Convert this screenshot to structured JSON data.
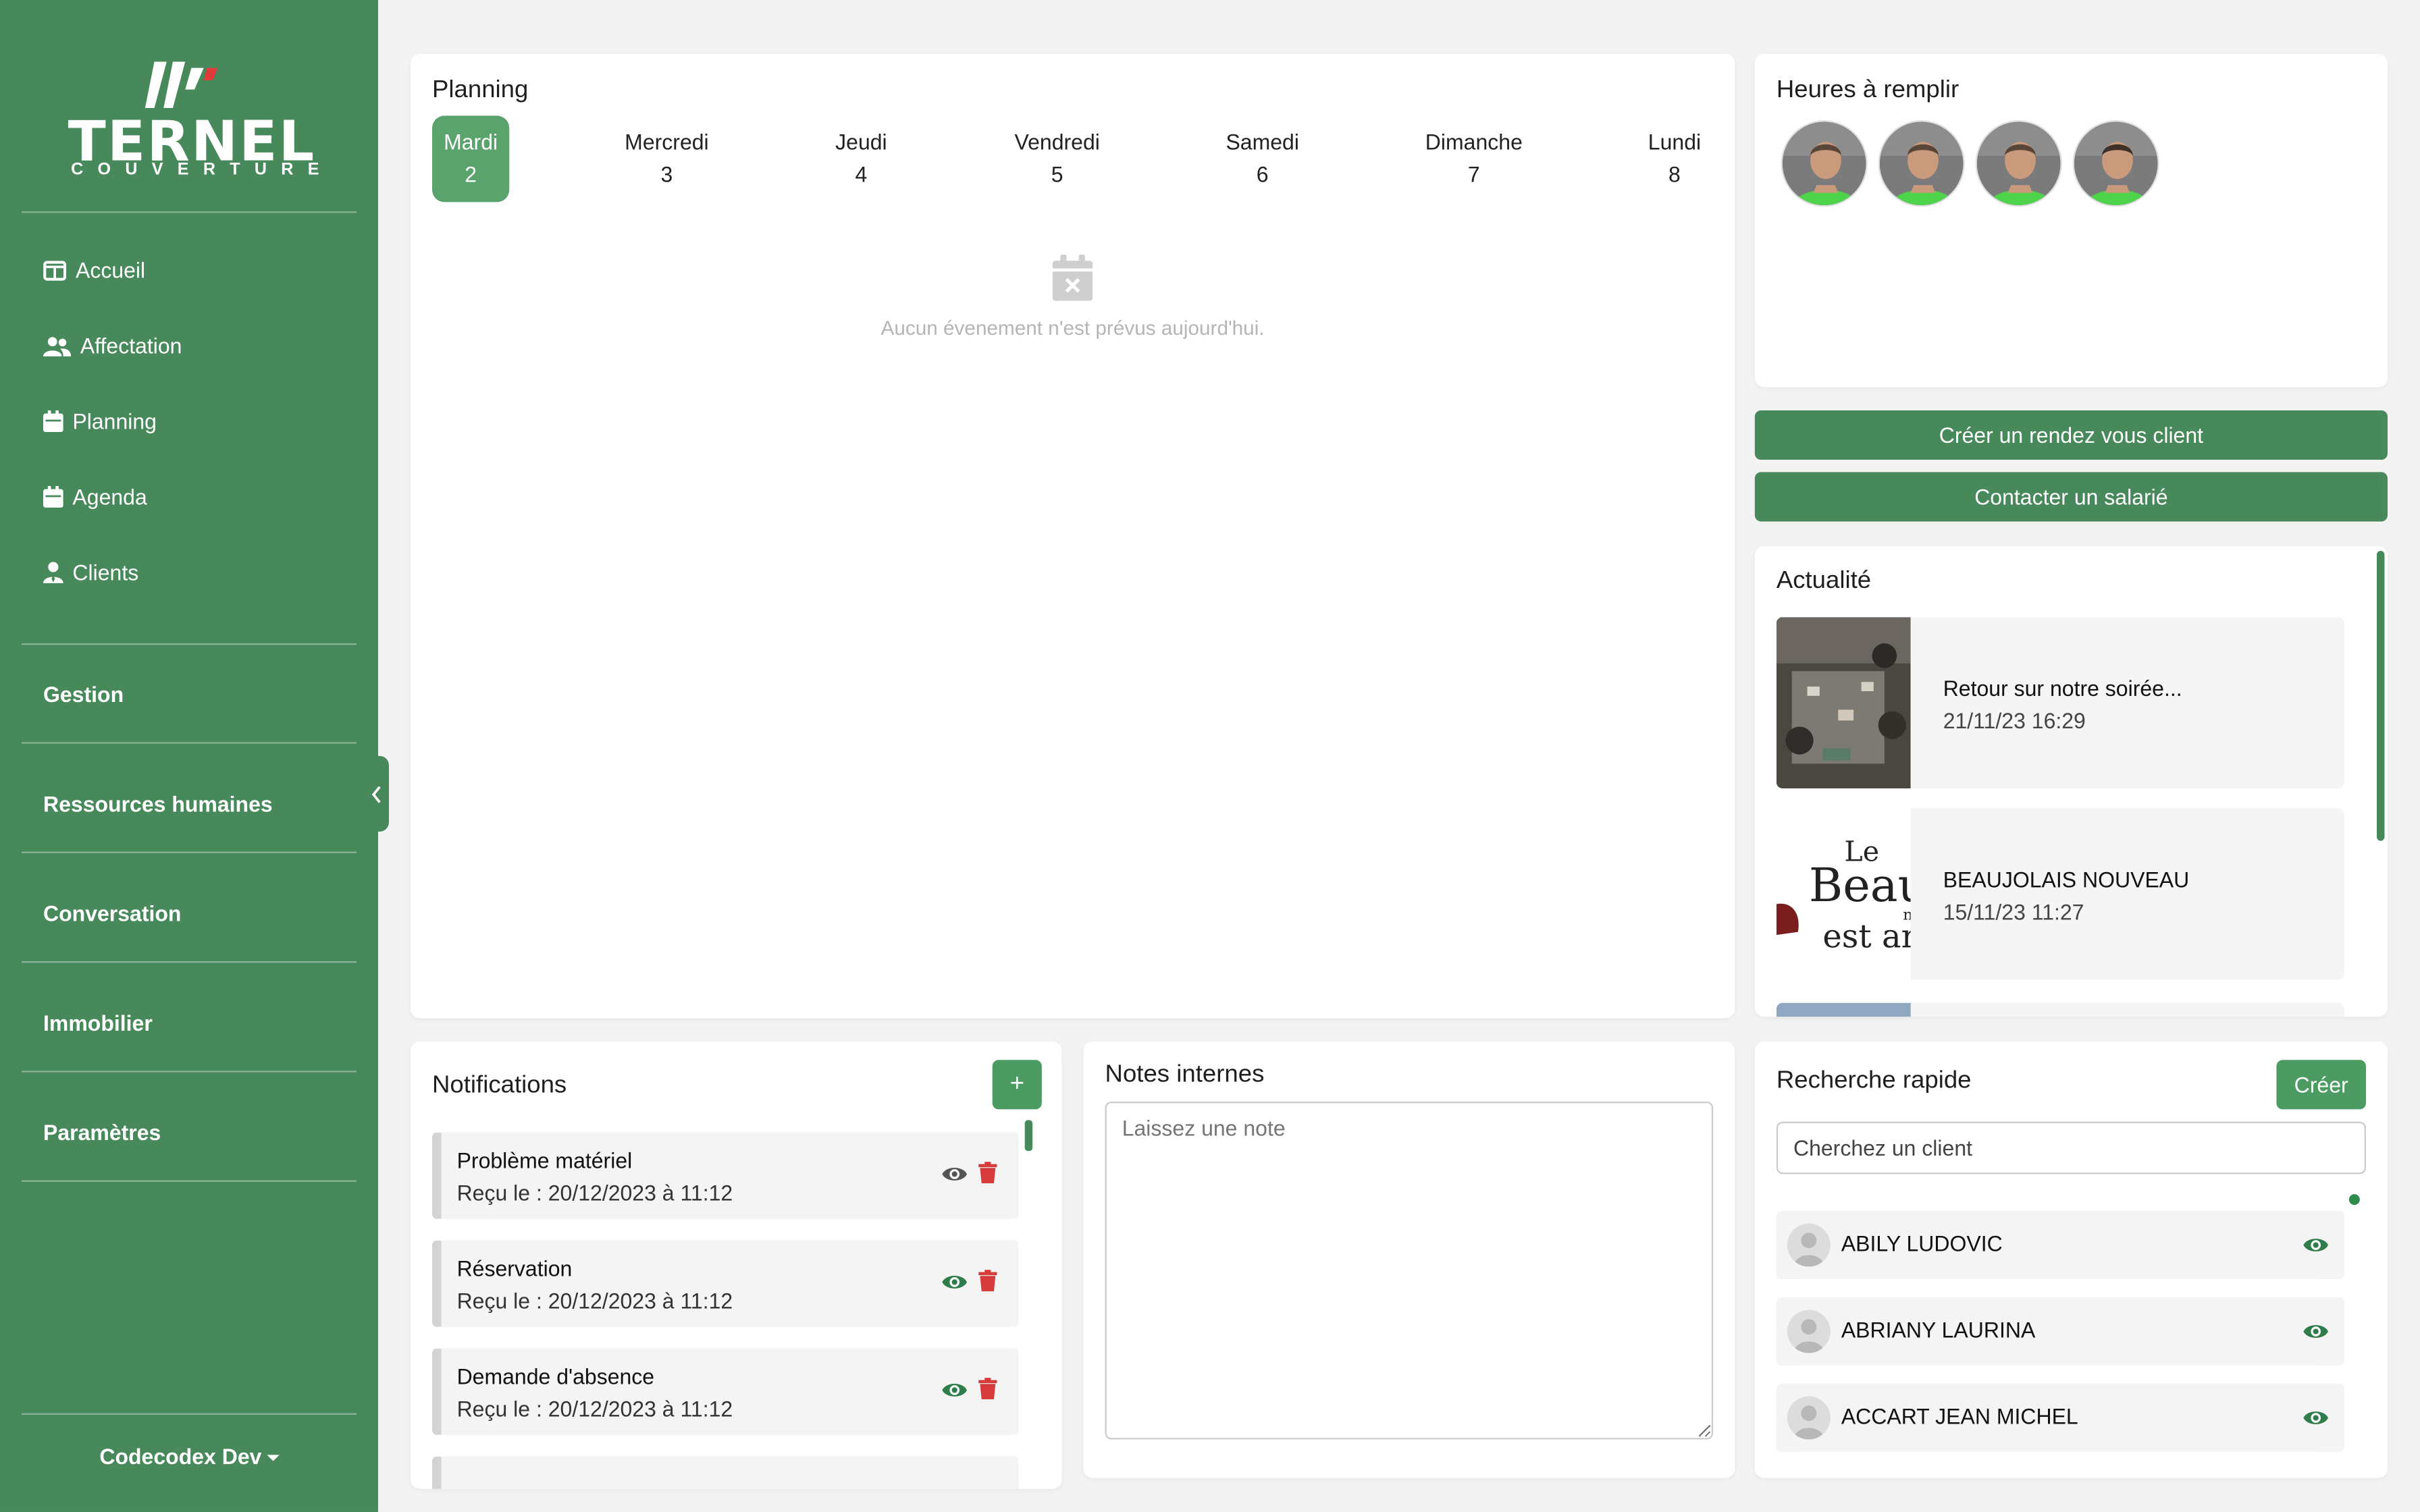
{
  "sidebar": {
    "logo_word": "TERNEL",
    "logo_sub": "COUVERTURE",
    "nav": [
      {
        "label": "Accueil",
        "icon": "table-columns-icon"
      },
      {
        "label": "Affectation",
        "icon": "users-icon"
      },
      {
        "label": "Planning",
        "icon": "calendar-icon"
      },
      {
        "label": "Agenda",
        "icon": "calendar-icon"
      },
      {
        "label": "Clients",
        "icon": "user-tie-icon"
      }
    ],
    "sections": [
      "Gestion",
      "Ressources humaines",
      "Conversation",
      "Immobilier",
      "Paramètres"
    ],
    "user": "Codecodex Dev"
  },
  "planning": {
    "title": "Planning",
    "days": [
      {
        "name": "Mardi",
        "date": "2",
        "active": true
      },
      {
        "name": "Mercredi",
        "date": "3"
      },
      {
        "name": "Jeudi",
        "date": "4"
      },
      {
        "name": "Vendredi",
        "date": "5"
      },
      {
        "name": "Samedi",
        "date": "6"
      },
      {
        "name": "Dimanche",
        "date": "7"
      },
      {
        "name": "Lundi",
        "date": "8"
      }
    ],
    "empty_text": "Aucun évenement n'est prévus aujourd'hui."
  },
  "heures": {
    "title": "Heures à remplir",
    "avatar_count": 4
  },
  "actions": {
    "create_rdv": "Créer un rendez vous client",
    "contact": "Contacter un salarié"
  },
  "actualite": {
    "title": "Actualité",
    "items": [
      {
        "title": "Retour sur notre soirée...",
        "date": "21/11/23 16:29"
      },
      {
        "title": "BEAUJOLAIS NOUVEAU",
        "date": "15/11/23 11:27"
      }
    ],
    "beaujolais_image_text": [
      "Le",
      "Beaujo",
      "n",
      "est arr"
    ]
  },
  "notifications": {
    "title": "Notifications",
    "add_label": "+",
    "items": [
      {
        "title": "Problème matériel",
        "date": "Reçu le : 20/12/2023 à 11:12",
        "eye_color": "#555555"
      },
      {
        "title": "Réservation",
        "date": "Reçu le : 20/12/2023 à 11:12",
        "eye_color": "#2e7d4a"
      },
      {
        "title": "Demande d'absence",
        "date": "Reçu le : 20/12/2023 à 11:12",
        "eye_color": "#2e7d4a"
      }
    ]
  },
  "notes": {
    "title": "Notes internes",
    "placeholder": "Laissez une note"
  },
  "recherche": {
    "title": "Recherche rapide",
    "create_label": "Créer",
    "placeholder": "Cherchez un client",
    "clients": [
      "ABILY LUDOVIC",
      "ABRIANY LAURINA",
      "ACCART JEAN MICHEL"
    ]
  },
  "colors": {
    "brand": "#47895a",
    "danger": "#d63b3b"
  }
}
